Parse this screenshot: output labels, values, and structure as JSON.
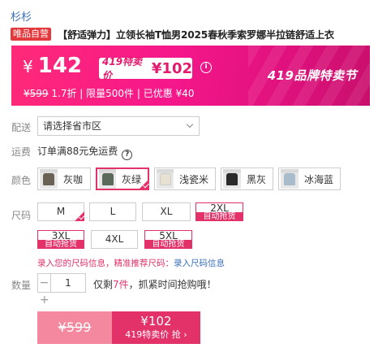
{
  "brand": "杉杉",
  "product": {
    "tag": "唯品自营",
    "title": "【舒适弹力】立领长袖T恤男2025春秋季索罗娜半拉链舒适上衣"
  },
  "promo": {
    "currency": "¥",
    "price": "142",
    "sale_label": "419特卖价",
    "sale_price": "¥102",
    "original": "¥599",
    "discount": "1.7折",
    "limit": "| 限量500件",
    "coupon": "| 已优惠 ¥40",
    "festival": "419品牌特卖节",
    "info_icon": "info-icon"
  },
  "delivery": {
    "label": "配送",
    "region_placeholder": "请选择省市区"
  },
  "shipping": {
    "label": "运费",
    "text": "订单满88元免运费",
    "icon": "question-icon"
  },
  "colors": {
    "label": "颜色",
    "options": [
      {
        "name": "灰咖",
        "swatch": "#6b6256"
      },
      {
        "name": "灰绿",
        "swatch": "#5b6a5a",
        "selected": true
      },
      {
        "name": "浅瓷米",
        "swatch": "#e7e0d3"
      },
      {
        "name": "黑灰",
        "swatch": "#2b2b2b"
      },
      {
        "name": "冰海蓝",
        "swatch": "#a9bccb"
      }
    ]
  },
  "sizes": {
    "label": "尺码",
    "options": [
      {
        "name": "M",
        "selected": true
      },
      {
        "name": "L"
      },
      {
        "name": "XL"
      },
      {
        "name": "2XL",
        "badge": "自动抢货"
      },
      {
        "name": "3XL",
        "badge": "自动抢货"
      },
      {
        "name": "4XL"
      },
      {
        "name": "5XL",
        "badge": "自动抢货"
      }
    ],
    "hint": "录入您的尺码信息，精准推荐尺码：",
    "hint_link": "录入尺码信息"
  },
  "quantity": {
    "label": "数量",
    "value": "1",
    "minus": "−",
    "plus": "+",
    "stock_prefix": "仅剩",
    "stock_num": "7件",
    "stock_suffix": "，抓紧时间抢购哦！"
  },
  "buttons": {
    "original_price": "¥599",
    "sale_price": "¥102",
    "sale_action": "419特卖价 抢 ›"
  },
  "colors_theme": {
    "accent": "#e3326a",
    "link": "#3a6fb8"
  }
}
